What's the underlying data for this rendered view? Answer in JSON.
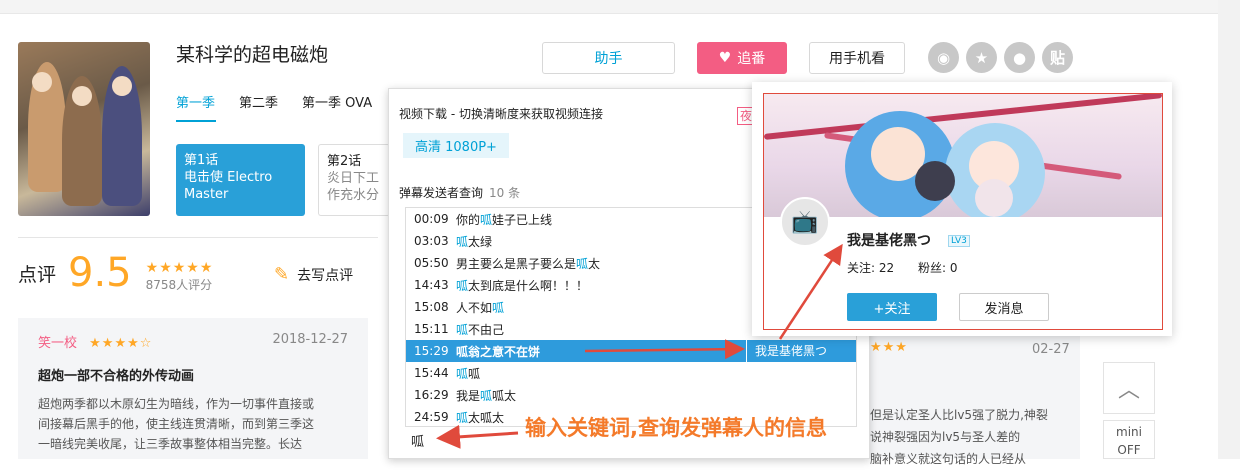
{
  "anime": {
    "title": "某科学的超电磁炮",
    "seasons": [
      "第一季",
      "第二季",
      "第一季 OVA"
    ],
    "episodes": [
      {
        "num": "第1话",
        "name": "电击使 Electro Master"
      },
      {
        "num": "第2话",
        "name": "炎日下工作充水分"
      }
    ]
  },
  "actions": {
    "helper_label": "助手",
    "follow_label": "追番",
    "follow_icon": "heart-icon",
    "mobile_label": "用手机看",
    "socials": [
      "weibo-icon",
      "qzone-icon",
      "qq-icon",
      "tieba-icon"
    ]
  },
  "review": {
    "label": "点评",
    "score": "9.5",
    "stars": "★★★★★",
    "count": "8758人评分",
    "write_label": "去写点评",
    "cards": [
      {
        "user": "笑一校",
        "stars": "★★★★☆",
        "date": "2018-12-27",
        "title": "超炮一部不合格的外传动画",
        "body_lines": [
          "超炮两季都以木原幻生为暗线，作为一切事件直接或",
          "间接幕后黑手的他，使主线连贯清晰，而到第三季这",
          "一暗线完美收尾，让三季故事整体相当完整。长达"
        ]
      },
      {
        "stars": "★★★",
        "date": "02-27",
        "body_lines": [
          "但是认定圣人比lv5强了脱力,神裂",
          "说神裂强因为lv5与圣人差的",
          "脑补意义就这句话的人已经从"
        ]
      }
    ]
  },
  "helper": {
    "download_title": "视频下载 - 切换清晰度来获取视频连接",
    "night_label": "夜",
    "quality": "高清 1080P+",
    "query_title": "弹幕发送者查询",
    "query_count": "10 条",
    "danmaku": [
      {
        "time": "00:09",
        "pre": "你的",
        "hl": "呱",
        "post": "娃子已上线"
      },
      {
        "time": "03:03",
        "pre": "",
        "hl": "呱",
        "post": "太绿"
      },
      {
        "time": "05:50",
        "pre": "男主要么是黑子要么是",
        "hl": "呱",
        "post": "太"
      },
      {
        "time": "14:43",
        "pre": "",
        "hl": "呱",
        "post": "太到底是什么啊！！！"
      },
      {
        "time": "15:08",
        "pre": "人不如",
        "hl": "呱",
        "post": ""
      },
      {
        "time": "15:11",
        "pre": "",
        "hl": "呱",
        "post": "不由己"
      },
      {
        "time": "15:29",
        "pre": "",
        "hl": "呱",
        "post": "翁之意不在饼",
        "sender": "我是基佬黑つ"
      },
      {
        "time": "15:44",
        "pre": "",
        "hl": "呱",
        "post": "呱"
      },
      {
        "time": "16:29",
        "pre": "我是",
        "hl": "呱",
        "post": "呱太"
      },
      {
        "time": "24:59",
        "pre": "",
        "hl": "呱",
        "post": "太呱太"
      }
    ],
    "input_value": "呱"
  },
  "user_card": {
    "name": "我是基佬黑つ",
    "level": "LV3",
    "following": "关注: 22",
    "fans": "粉丝: 0",
    "follow_btn": "+关注",
    "message_btn": "发消息"
  },
  "annotation": "输入关键词,查询发弹幕人的信息",
  "side": {
    "mini_line1": "mini",
    "mini_line2": "OFF"
  },
  "colors": {
    "accent": "#00a1d6",
    "pink": "#f35d83",
    "selected_row": "#2e9bdc",
    "annotation": "#f47a2a",
    "highlight_box": "#e04a3c"
  }
}
